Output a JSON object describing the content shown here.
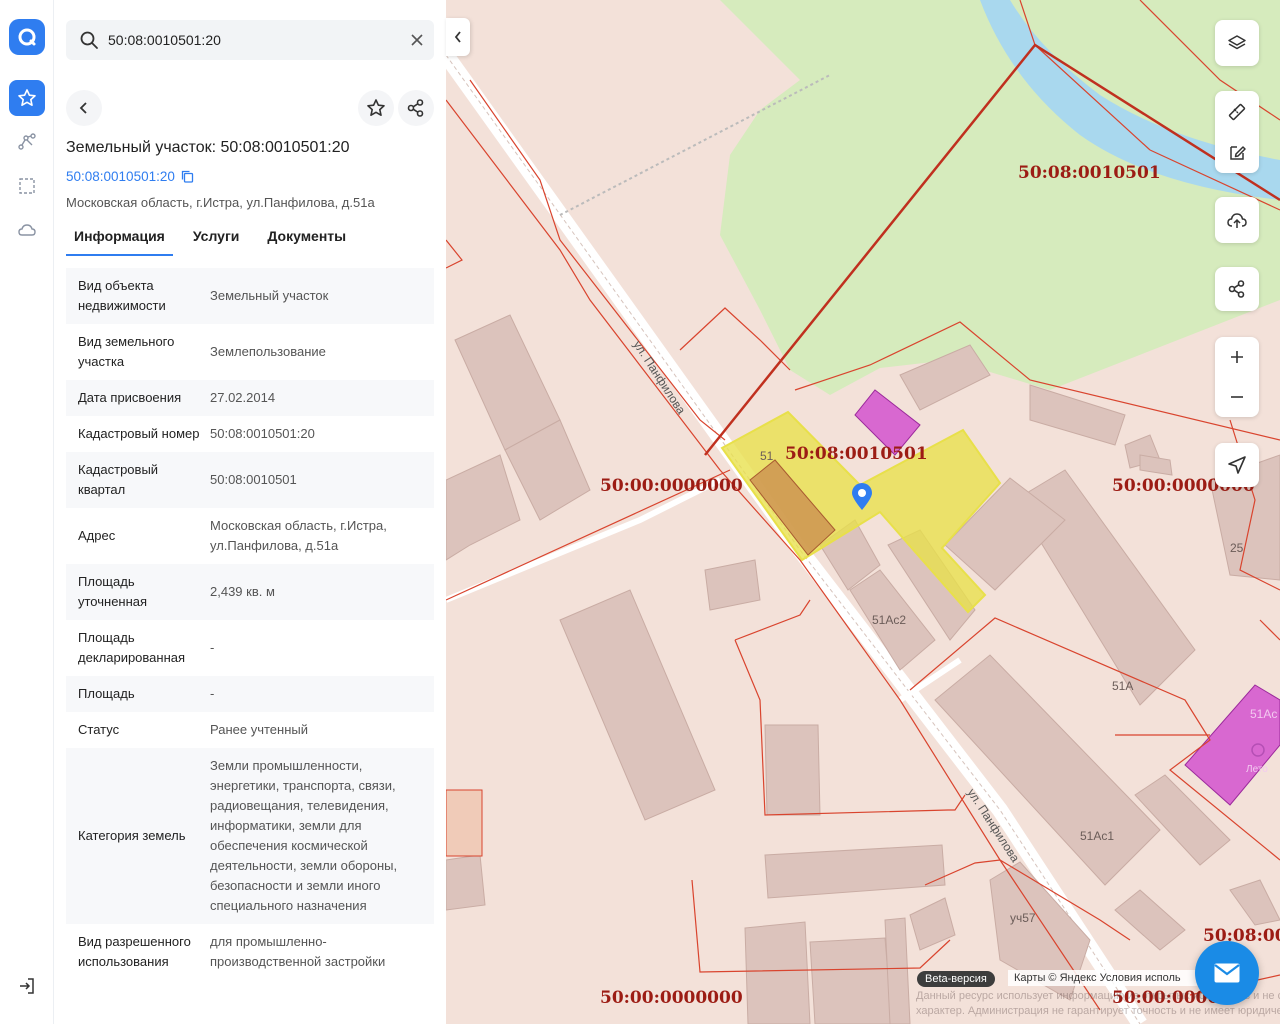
{
  "search": {
    "value": "50:08:0010501:20"
  },
  "object": {
    "title": "Земельный участок: 50:08:0010501:20",
    "cadastral_link": "50:08:0010501:20",
    "address": "Московская область, г.Истра, ул.Панфилова, д.51а"
  },
  "tabs": [
    "Информация",
    "Услуги",
    "Документы"
  ],
  "info_rows": [
    {
      "label": "Вид объекта недвижимости",
      "value": "Земельный участок"
    },
    {
      "label": "Вид земельного участка",
      "value": "Землепользование"
    },
    {
      "label": "Дата присвоения",
      "value": "27.02.2014"
    },
    {
      "label": "Кадастровый номер",
      "value": "50:08:0010501:20"
    },
    {
      "label": "Кадастровый квартал",
      "value": "50:08:0010501"
    },
    {
      "label": "Адрес",
      "value": "Московская область, г.Истра, ул.Панфилова, д.51а"
    },
    {
      "label": "Площадь уточненная",
      "value": "2,439 кв. м"
    },
    {
      "label": "Площадь декларированная",
      "value": "-"
    },
    {
      "label": "Площадь",
      "value": "-"
    },
    {
      "label": "Статус",
      "value": "Ранее учтенный"
    },
    {
      "label": "Категория земель",
      "value": "Земли промышленности, энергетики, транспорта, связи, радиовещания, телевидения, информатики, земли для обеспечения космической деятельности, земли обороны, безопасности и земли иного специального назначения"
    },
    {
      "label": "Вид разрешенного использования",
      "value": "для промышленно-производственной застройки"
    }
  ],
  "map": {
    "quarter_labels": [
      "50:08:0010501",
      "50:08:0010501",
      "50:00:0000000",
      "50:00:0000000",
      "50:00:0000000",
      "50:08:00",
      "50:00:00000"
    ],
    "street_labels": [
      "ул. Панфилова",
      "ул. Панфилова"
    ],
    "house_labels": [
      "51",
      "51Ас2",
      "51А",
      "51Ас1",
      "25",
      "уч57",
      "51Ас",
      "Лето"
    ],
    "beta_badge": "Beta-версия",
    "attribution": "Карты © Яндекс  Условия исполь",
    "disclaimer": "Данный ресурс использует информацию из открытых источников и не связан с Росреестром. Вся информация носит справочный характер. Администрация не гарантирует точность и не имеет юридической силы. За официальными сведениями обращайтесь в Росреестр."
  },
  "colors": {
    "accent": "#2f7df0",
    "parcel_highlight": "#e8e04a",
    "boundary": "#d9442e",
    "park": "#d6ebbd",
    "river": "#a9d8ee",
    "building": "#dcc3bc",
    "purple_parcel": "#d868d0"
  }
}
